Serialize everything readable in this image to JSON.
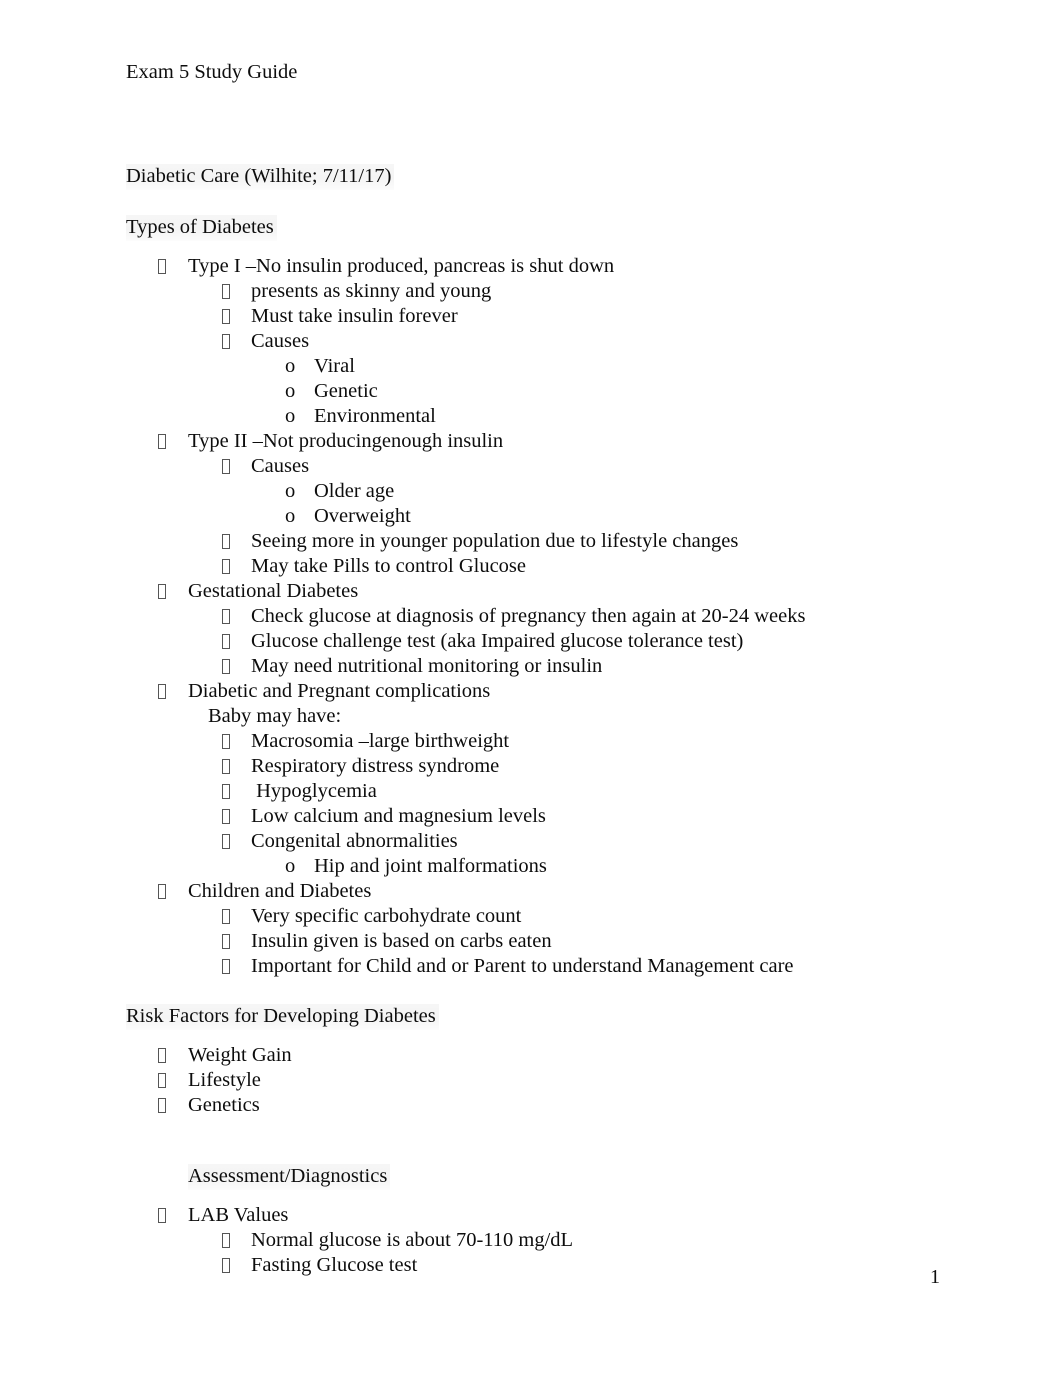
{
  "document": {
    "header": "Exam 5 Study Guide",
    "page_number": "1",
    "bullet_glyph": "missing-glyph-box"
  },
  "sections": [
    {
      "heading": "Diabetic Care (Wilhite; 7/11/17)"
    },
    {
      "heading": "Types of Diabetes",
      "items": [
        {
          "level": 1,
          "marker": "tofu",
          "text": "Type I –No insulin produced, pancreas is shut down"
        },
        {
          "level": 2,
          "marker": "tofu",
          "text": "presents as skinny and young"
        },
        {
          "level": 2,
          "marker": "tofu",
          "text": "Must take insulin forever"
        },
        {
          "level": 2,
          "marker": "tofu",
          "text": "Causes"
        },
        {
          "level": 3,
          "marker": "o",
          "text": "Viral"
        },
        {
          "level": 3,
          "marker": "o",
          "text": "Genetic"
        },
        {
          "level": 3,
          "marker": "o",
          "text": "Environmental"
        },
        {
          "level": 1,
          "marker": "tofu",
          "text": "Type II –Not producingenough insulin"
        },
        {
          "level": 2,
          "marker": "tofu",
          "text": "Causes"
        },
        {
          "level": 3,
          "marker": "o",
          "text": "Older age"
        },
        {
          "level": 3,
          "marker": "o",
          "text": "Overweight"
        },
        {
          "level": 2,
          "marker": "tofu",
          "text": "Seeing more in younger population due to lifestyle changes"
        },
        {
          "level": 2,
          "marker": "tofu",
          "text": "May take Pills to control Glucose"
        },
        {
          "level": 1,
          "marker": "tofu",
          "text": "Gestational Diabetes"
        },
        {
          "level": 2,
          "marker": "tofu",
          "text": "Check glucose at diagnosis of pregnancy then again at 20-24 weeks"
        },
        {
          "level": 2,
          "marker": "tofu",
          "text": "Glucose challenge test (aka Impaired glucose tolerance test)"
        },
        {
          "level": 2,
          "marker": "tofu",
          "text": "May need nutritional monitoring or insulin"
        },
        {
          "level": 1,
          "marker": "tofu",
          "text": "Diabetic and Pregnant complications"
        },
        {
          "level": 0,
          "marker": "none",
          "text": "Baby may have:"
        },
        {
          "level": 2,
          "marker": "tofu",
          "text": "Macrosomia –large birthweight"
        },
        {
          "level": 2,
          "marker": "tofu",
          "text": "Respiratory distress syndrome"
        },
        {
          "level": 2,
          "marker": "tofu",
          "text": " Hypoglycemia"
        },
        {
          "level": 2,
          "marker": "tofu",
          "text": "Low calcium and magnesium levels"
        },
        {
          "level": 2,
          "marker": "tofu",
          "text": "Congenital abnormalities"
        },
        {
          "level": 3,
          "marker": "o",
          "text": "Hip and joint malformations"
        },
        {
          "level": 1,
          "marker": "tofu",
          "text": "Children and Diabetes"
        },
        {
          "level": 2,
          "marker": "tofu",
          "text": "Very specific carbohydrate count"
        },
        {
          "level": 2,
          "marker": "tofu",
          "text": "Insulin given is based on carbs eaten"
        },
        {
          "level": 2,
          "marker": "tofu",
          "text": "Important for Child and or Parent to understand Management care"
        }
      ]
    },
    {
      "heading": "Risk Factors for Developing Diabetes",
      "items": [
        {
          "level": 1,
          "marker": "tofu",
          "text": "Weight Gain"
        },
        {
          "level": 1,
          "marker": "tofu",
          "text": "Lifestyle"
        },
        {
          "level": 1,
          "marker": "tofu",
          "text": "Genetics"
        }
      ]
    },
    {
      "heading": "Assessment/Diagnostics",
      "heading_indented": true,
      "items": [
        {
          "level": 1,
          "marker": "tofu",
          "text": "LAB Values"
        },
        {
          "level": 2,
          "marker": "tofu",
          "text": "Normal glucose is about 70-110 mg/dL"
        },
        {
          "level": 2,
          "marker": "tofu",
          "text": "Fasting Glucose test"
        }
      ]
    }
  ]
}
